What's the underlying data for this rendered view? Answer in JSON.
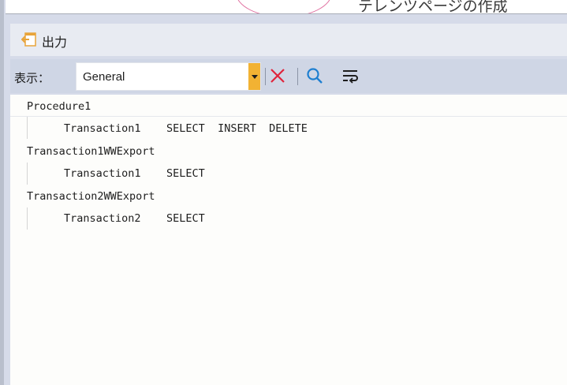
{
  "document": {
    "partial_text": "テレンツページの作成"
  },
  "panel": {
    "title": "出力",
    "icon": "output-window-icon"
  },
  "toolbar": {
    "show_label": "表示：",
    "source_value": "General",
    "buttons": [
      {
        "name": "clear-button",
        "icon": "red-x-icon",
        "color": "#e0243c"
      },
      {
        "name": "find-button",
        "icon": "search-icon",
        "color": "#1e7fd0"
      },
      {
        "name": "word-wrap-button",
        "icon": "word-wrap-icon",
        "color": "#1e1e1e"
      }
    ]
  },
  "output": {
    "lines": [
      {
        "indent": false,
        "text": "Procedure1"
      },
      {
        "indent": true,
        "text": "Transaction1    SELECT  INSERT  DELETE"
      },
      {
        "indent": false,
        "text": "Transaction1WWExport"
      },
      {
        "indent": true,
        "text": "Transaction1    SELECT"
      },
      {
        "indent": false,
        "text": "Transaction2WWExport"
      },
      {
        "indent": true,
        "text": "Transaction2    SELECT"
      }
    ]
  }
}
